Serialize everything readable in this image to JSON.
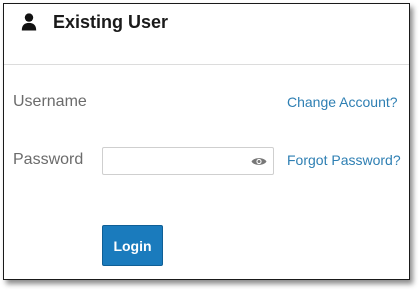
{
  "header": {
    "title": "Existing User",
    "icon": "user-icon"
  },
  "form": {
    "username_label": "Username",
    "change_account_link": "Change Account?",
    "password_label": "Password",
    "password_value": "",
    "forgot_password_link": "Forgot Password?",
    "show_password_icon": "eye-icon",
    "login_button": "Login"
  },
  "colors": {
    "accent": "#1a7bbd",
    "link": "#2e7fb3",
    "label": "#6b6b6b"
  }
}
